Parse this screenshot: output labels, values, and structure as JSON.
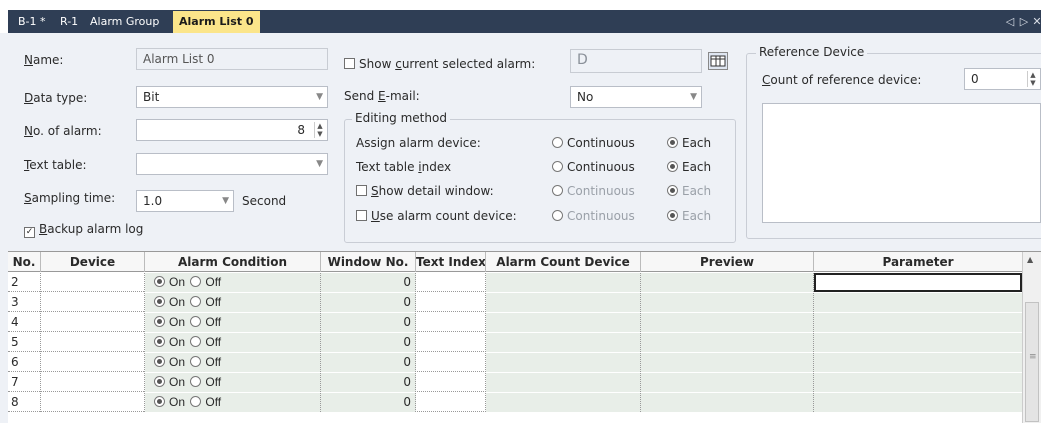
{
  "tabs": [
    {
      "label": "B-1 *",
      "active": false
    },
    {
      "label": "R-1",
      "active": false
    },
    {
      "label": "Alarm Group",
      "active": false
    },
    {
      "label": "Alarm List 0",
      "active": true
    }
  ],
  "tab_controls": {
    "prev": "◁",
    "next": "▷",
    "close": "✕"
  },
  "form": {
    "name_label_u": "N",
    "name_label_rest": "ame:",
    "name_value": "Alarm List 0",
    "datatype_label_u": "D",
    "datatype_label_rest": "ata type:",
    "datatype_value": "Bit",
    "noalarm_label_u": "N",
    "noalarm_label_rest": "o. of alarm:",
    "noalarm_value": "8",
    "texttable_label_u": "T",
    "texttable_label_rest": "ext table:",
    "texttable_value": "",
    "sampling_label_u": "S",
    "sampling_label_rest": "ampling time:",
    "sampling_value": "1.0",
    "sampling_unit": "Second",
    "backup_label_u": "B",
    "backup_label_rest": "ackup alarm log",
    "backup_checked": true,
    "show_current_pre": "Show ",
    "show_current_u": "c",
    "show_current_rest": "urrent selected alarm:",
    "show_current_value": "D",
    "send_email_pre": "Send ",
    "send_email_u": "E",
    "send_email_rest": "-mail:",
    "send_email_value": "No",
    "editing": {
      "title": "Editing method",
      "rows": [
        {
          "label": "Assign alarm device:",
          "opt1": "Continuous",
          "opt2": "Each",
          "selected": 2,
          "checkbox": false,
          "enabled": true
        },
        {
          "label_pre": "Text table ",
          "label_u": "i",
          "label_rest": "ndex",
          "opt1": "Continuous",
          "opt2": "Each",
          "selected": 2,
          "checkbox": false,
          "enabled": true
        },
        {
          "label_u": "S",
          "label_rest": "how detail window:",
          "opt1": "Continuous",
          "opt2": "Each",
          "selected": 2,
          "checkbox": true,
          "enabled": false
        },
        {
          "label_u": "U",
          "label_rest": "se alarm count device:",
          "opt1": "Continuous",
          "opt2": "Each",
          "selected": 2,
          "checkbox": true,
          "enabled": false
        }
      ]
    },
    "reference": {
      "title": "Reference Device",
      "count_label_u": "C",
      "count_label_rest": "ount of reference device:",
      "count_value": "0"
    }
  },
  "grid": {
    "columns": [
      "No.",
      "Device",
      "Alarm Condition",
      "Window No.",
      "Text Index",
      "Alarm Count Device",
      "Preview",
      "Parameter"
    ],
    "on_label": "On",
    "off_label": "Off",
    "rows": [
      {
        "no": "2",
        "window": "0"
      },
      {
        "no": "3",
        "window": "0"
      },
      {
        "no": "4",
        "window": "0"
      },
      {
        "no": "5",
        "window": "0"
      },
      {
        "no": "6",
        "window": "0"
      },
      {
        "no": "7",
        "window": "0"
      },
      {
        "no": "8",
        "window": "0"
      }
    ]
  }
}
